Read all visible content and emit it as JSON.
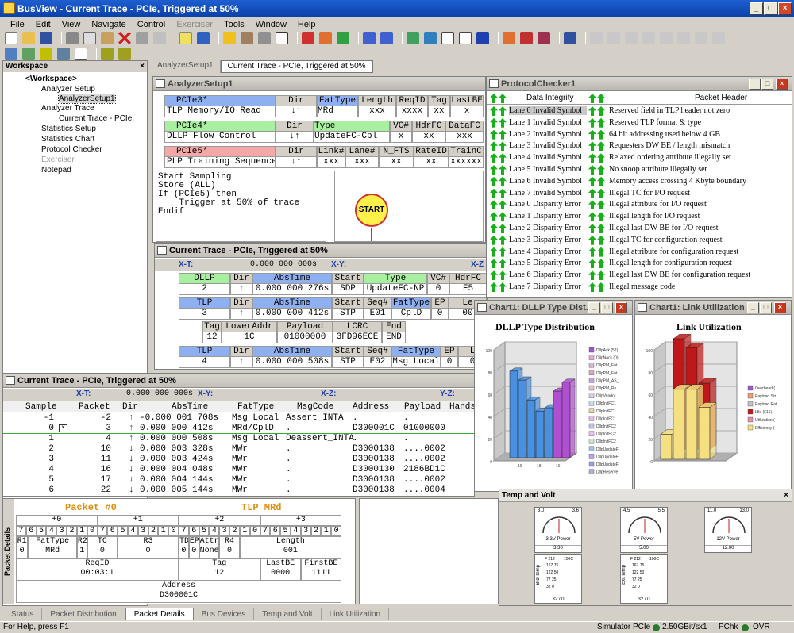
{
  "app": {
    "title": "BusView - Current Trace - PCIe, Triggered at 50%"
  },
  "menu": [
    "File",
    "Edit",
    "View",
    "Navigate",
    "Control",
    "Exerciser",
    "Tools",
    "Window",
    "Help"
  ],
  "workspace": {
    "title": "Workspace",
    "items": [
      "<Workspace>",
      "Analyzer Setup",
      "AnalyzerSetup1",
      "Analyzer Trace",
      "Current Trace - PCIe,",
      "Statistics Setup",
      "Statistics Chart",
      "Protocol Checker",
      "Exerciser",
      "Notepad"
    ]
  },
  "doc_tabs": [
    "AnalyzerSetup1",
    "Current Trace - PCIe, Triggered at 50%"
  ],
  "setup": {
    "title": "AnalyzerSetup1",
    "r1": {
      "name": "PCIe3*",
      "dir": "Dir",
      "c1": "FatType",
      "c2": "Length",
      "c3": "ReqID",
      "c4": "Tag",
      "c5": "LastBE",
      "desc": "TLP Memory/IO Read",
      "v1": "MRd",
      "v2": "xxx",
      "v3": "xxxx",
      "v4": "xx",
      "v5": "x"
    },
    "r2": {
      "name": "PCIe4*",
      "dir": "Dir",
      "c1": "Type",
      "c2": "VC#",
      "c3": "HdrFC",
      "c4": "DataFC",
      "desc": "DLLP Flow Control",
      "v1": "UpdateFC-Cpl",
      "v2": "x",
      "v3": "xx",
      "v4": "xxx"
    },
    "r3": {
      "name": "PCIe5*",
      "dir": "Dir",
      "c1": "Link#",
      "c2": "Lane#",
      "c3": "N_FTS",
      "c4": "RateID",
      "c5": "TrainC",
      "desc": "PLP Training Sequence",
      "v1": "xxx",
      "v2": "xxx",
      "v3": "xx",
      "v4": "xx",
      "v5": "xxxxxx"
    },
    "script": [
      "Start Sampling",
      "Store (ALL)",
      "If (PCIe5) then",
      "    Trigger at 50% of trace",
      "Endif"
    ],
    "start_label": "START"
  },
  "trace1": {
    "title": "Current Trace - PCIe, Triggered at 50%",
    "xt_label": "X-T:",
    "xt_value": "0.000 000 000s",
    "xy_label": "X-Y:",
    "xz_label": "X-Z",
    "dllp": {
      "h": [
        "DLLP",
        "Dir",
        "AbsTime",
        "Start",
        "Type",
        "VC#",
        "HdrFC"
      ],
      "v": [
        "2",
        "",
        "0.000 000 276s",
        "SDP",
        "UpdateFC-NP",
        "0",
        "F5"
      ]
    },
    "tlp1": {
      "h": [
        "TLP",
        "Dir",
        "AbsTime",
        "Start",
        "Seq#",
        "FatType",
        "EP",
        "Le"
      ],
      "v": [
        "3",
        "",
        "0.000 000 412s",
        "STP",
        "E01",
        "CplD",
        "0",
        "00"
      ]
    },
    "tlp1b": {
      "h": [
        "Tag",
        "LowerAddr",
        "Payload",
        "LCRC",
        "End"
      ],
      "v": [
        "12",
        "1C",
        "01000000",
        "3FD96ECE",
        "END"
      ]
    },
    "tlp2": {
      "h": [
        "TLP",
        "Dir",
        "AbsTime",
        "Start",
        "Seq#",
        "FatType",
        "EP",
        "L"
      ],
      "v": [
        "4",
        "",
        "0.000 000 508s",
        "STP",
        "E02",
        "Msg Local",
        "0",
        "0"
      ]
    }
  },
  "trace2": {
    "title": "Current Trace - PCIe, Triggered at 50%",
    "xt_label": "X-T:",
    "xt_value": "0.000 000 000s",
    "xy_label": "X-Y:",
    "xz_label": "X-Z:",
    "yz_label": "Y-Z:",
    "columns": [
      "Sample",
      "Packet",
      "Dir",
      "AbsTime",
      "FatType",
      "MsgCode",
      "Address",
      "Payload",
      "Hands"
    ],
    "rows": [
      [
        "-1",
        "-2",
        "↑",
        "-0.000 001 708s",
        "Msg Local",
        "Assert_INTA",
        ".",
        "."
      ],
      [
        "0",
        "3",
        "↑",
        "0.000 000 412s",
        "MRd/CplD",
        ".",
        "D300001C",
        "01000000"
      ],
      [
        "1",
        "4",
        "↑",
        "0.000 000 508s",
        "Msg Local",
        "Deassert_INTA",
        ".",
        "."
      ],
      [
        "2",
        "10",
        "↓",
        "0.000 003 328s",
        "MWr",
        ".",
        "D3000138",
        "....0002"
      ],
      [
        "3",
        "11",
        "↓",
        "0.000 003 424s",
        "MWr",
        ".",
        "D3000138",
        "....0002"
      ],
      [
        "4",
        "16",
        "↓",
        "0.000 004 048s",
        "MWr",
        ".",
        "D3000130",
        "2186BD1C"
      ],
      [
        "5",
        "17",
        "↓",
        "0.000 004 144s",
        "MWr",
        ".",
        "D3000138",
        "....0002"
      ],
      [
        "6",
        "22",
        "↓",
        "0.000 005 144s",
        "MWr",
        ".",
        "D3000138",
        "....0004"
      ]
    ]
  },
  "packet": {
    "side_label": "Packet Details",
    "title": "Packet #0",
    "type": "TLP MRd",
    "offsets": [
      "+0",
      "+1",
      "+2",
      "+3"
    ],
    "bits": [
      "7",
      "6",
      "5",
      "4",
      "3",
      "2",
      "1",
      "0"
    ],
    "f": {
      "r1": "R1",
      "r1v": "0",
      "fat": "FatType",
      "fatv": "MRd",
      "r2": "R2",
      "r2v": "1",
      "tc": "TC",
      "tcv": "0",
      "r3": "R3",
      "r3v": "0",
      "td": "TD",
      "tdv": "0",
      "ep": "EP",
      "epv": "0",
      "attr": "Attr",
      "attrv": "None",
      "r4": "R4",
      "r4v": "0",
      "len": "Length",
      "lenv": "001",
      "req": "ReqID",
      "reqv": "00:03:1",
      "tag": "Tag",
      "tagv": "12",
      "lbe": "LastBE",
      "lbev": "0000",
      "fbe": "FirstBE",
      "fbev": "1111",
      "addr": "Address",
      "addrv": "D300001C"
    }
  },
  "protocol": {
    "title": "ProtocolChecker1",
    "col1": "Data Integrity",
    "col2": "Packet Header",
    "left": [
      "Lane 0 Invalid Symbol",
      "Lane 1 Invalid Symbol",
      "Lane 2 Invalid Symbol",
      "Lane 3 Invalid Symbol",
      "Lane 4 Invalid Symbol",
      "Lane 5 Invalid Symbol",
      "Lane 6 Invalid Symbol",
      "Lane 7 Invalid Symbol",
      "Lane 0 Disparity Error",
      "Lane 1 Disparity Error",
      "Lane 2 Disparity Error",
      "Lane 3 Disparity Error",
      "Lane 4 Disparity Error",
      "Lane 5 Disparity Error",
      "Lane 6 Disparity Error",
      "Lane 7 Disparity Error"
    ],
    "right": [
      "Reserved field in TLP header not zero",
      "Reserved TLP format & type",
      "64 bit addressing used below 4 GB",
      "Requesters DW BE / length mismatch",
      "Relaxed ordering attribute illegally set",
      "No snoop attribute illegally set",
      "Memory access crossing 4 Kbyte boundary",
      "Illegal TC for I/O request",
      "Illegal attribute for I/O request",
      "Illegal length for I/O request",
      "Illegal last DW BE for I/O request",
      "Illegal TC for configuration request",
      "Illegal attribute for configuration request",
      "Illegal length for configuration request",
      "Illegal last DW BE for configuration request",
      "Illegal message code"
    ]
  },
  "chart1": {
    "window_title": "Chart1: DLLP Type Dist...",
    "title": "DLLP Type Distribution",
    "legend": [
      "DllpAck (52)",
      "DllpNack (0)",
      "DllpPM_Ent",
      "DllpPM_Ent",
      "DllpPM_AS_",
      "DllpPM_Re",
      "DllpVendor",
      "DllpInitFC1",
      "DllpInitFC1",
      "DllpInitFC1",
      "DllpInitFC2",
      "DllpInitFC2",
      "DllpInitFC2",
      "DllpUpdateF",
      "DllpUpdateF",
      "DllpUpdateF",
      "DllpReserve"
    ],
    "legend_colors": [
      "#9b59d0",
      "#f2a3d0",
      "#d8b0e0",
      "#e8a0c0",
      "#c8a0e8",
      "#f0c0c0",
      "#d0d0f0",
      "#c0e0f0",
      "#f0d0a0",
      "#e0c0e0",
      "#c0c0f0",
      "#f0c0f0",
      "#d0e0c0",
      "#a0c0f0",
      "#c0a0f0",
      "#8fa0e8",
      "#b0b0d0"
    ],
    "y_ticks": [
      "100",
      "80",
      "60",
      "40",
      "20",
      "0"
    ],
    "x_ticks": [
      "16",
      "18",
      "16"
    ],
    "series": [
      {
        "values": [
          78,
          70,
          52,
          42,
          45,
          60,
          68
        ]
      }
    ]
  },
  "chart2": {
    "window_title": "Chart1: Link Utilization",
    "title": "Link Utilization",
    "legend": [
      "Overhead (",
      "Payload Siz",
      "Payload Rat",
      "Idle (616)",
      "Utilization (",
      "Efficiency ("
    ],
    "legend_colors": [
      "#9b59d0",
      "#f09a7a",
      "#c0c0c0",
      "#c01818",
      "#e090b0",
      "#f4e080"
    ],
    "y_ticks": [
      "100",
      "80",
      "60",
      "40",
      "20",
      "0"
    ],
    "series": [
      {
        "color": "#c01818",
        "values": [
          100,
          92,
          60
        ]
      },
      {
        "color": "#f4e080",
        "values": [
          25,
          70,
          70,
          52
        ]
      }
    ]
  },
  "temp": {
    "title": "Temp and Volt",
    "g1": {
      "min": "3.0",
      "max": "3.6",
      "label": "3.3V Power",
      "value": "3.30"
    },
    "g2": {
      "min": "4.5",
      "max": "5.5",
      "label": "5V Power",
      "value": "5.00"
    },
    "g3": {
      "min": "11.0",
      "max": "13.0",
      "label": "12V Power",
      "value": "12.00"
    },
    "t1": {
      "label": "Brd Temp",
      "f": "F 212",
      "c": "100C",
      "rows": [
        "167 75",
        "122 50",
        "77 25",
        "32 0"
      ],
      "value": "32 / 0"
    },
    "t2": {
      "label": "Ext Temp",
      "f": "F 212",
      "c": "100C",
      "rows": [
        "167 75",
        "122 50",
        "77 25",
        "32 0"
      ],
      "value": "32 / 0"
    }
  },
  "bottom_tabs": [
    "Status",
    "Packet Distribution",
    "Packet Details",
    "Bus Devices",
    "Temp and Volt",
    "Link Utilization"
  ],
  "status": {
    "help": "For Help, press F1",
    "sim": "Simulator PCIe",
    "rate": "2.50GBit/s",
    "lanes": "x1",
    "pchk": "PChk",
    "ovr": "OVR"
  }
}
